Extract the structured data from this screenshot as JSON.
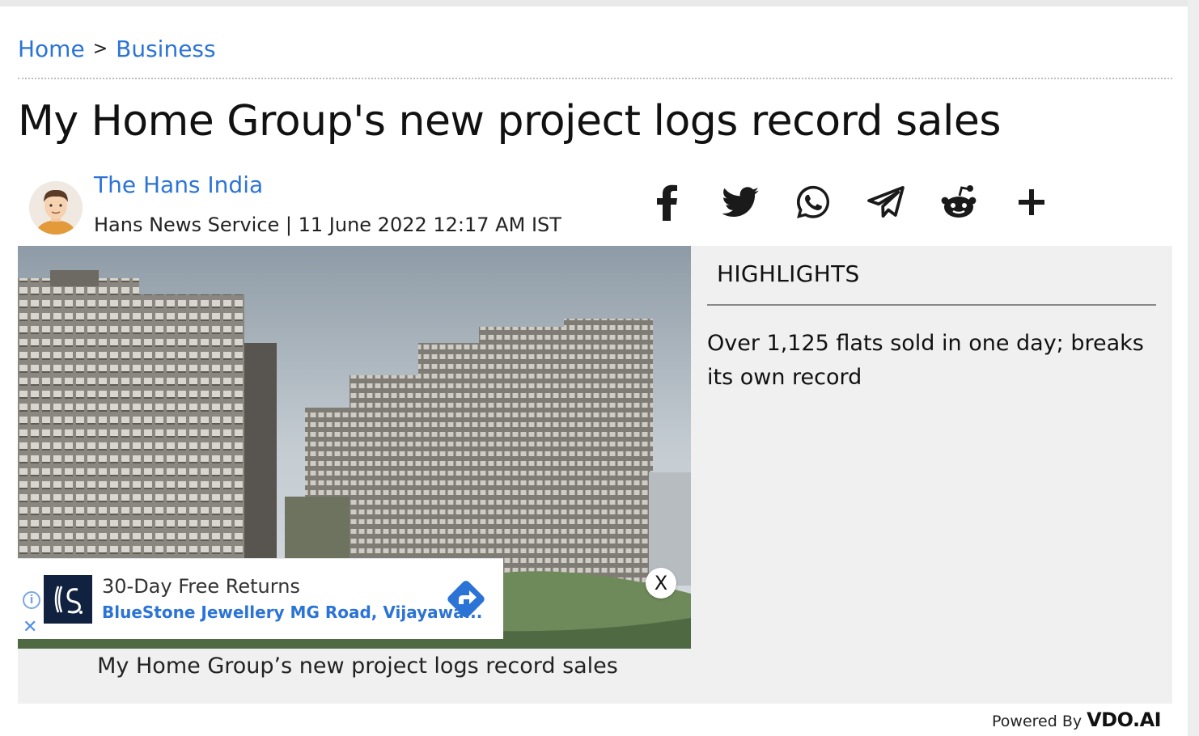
{
  "breadcrumb": {
    "items": [
      "Home",
      "Business"
    ],
    "separator": ">"
  },
  "article": {
    "title": "My Home Group's new project logs record sales",
    "author": "The Hans India",
    "byline": "Hans News Service | 11 June 2022 12:17 AM IST",
    "image_caption": "My Home Group’s new project logs record sales"
  },
  "share": {
    "icons": [
      "facebook-icon",
      "twitter-icon",
      "whatsapp-icon",
      "telegram-icon",
      "reddit-icon",
      "plus-icon"
    ]
  },
  "highlights": {
    "heading": "HIGHLIGHTS",
    "text": "Over 1,125 flats sold in one day; breaks its own record"
  },
  "ad": {
    "title": "30-Day Free Returns",
    "subtitle": "BlueStone Jewellery MG Road, Vijayawa...",
    "close_label": "X"
  },
  "footer": {
    "powered_by": "Powered By",
    "brand": "VDO.AI"
  },
  "colors": {
    "link": "#2b74d6",
    "highlight_bg": "#f0f0f0",
    "ad_accent": "#4c8ce0"
  }
}
